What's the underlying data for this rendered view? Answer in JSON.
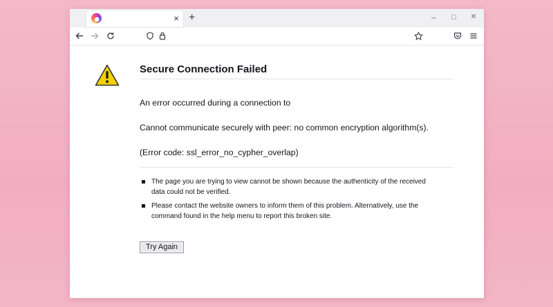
{
  "browser": {
    "tab": {
      "title": "",
      "close_glyph": "×",
      "favicon": "browser-logo-icon"
    },
    "new_tab_glyph": "+",
    "window_controls": {
      "minimize": "–",
      "maximize": "□",
      "close": "×"
    },
    "nav": {
      "back": "arrow-left-icon",
      "forward": "arrow-right-icon",
      "reload": "reload-icon",
      "address_text": ""
    }
  },
  "error_page": {
    "title": "Secure Connection Failed",
    "line1": "An error occurred during a connection to",
    "line2": "Cannot communicate securely with peer: no common encryption algorithm(s).",
    "line3": "(Error code: ssl_error_no_cypher_overlap)",
    "bullets": [
      "The page you are trying to view cannot be shown because the authenticity of the received data could not be verified.",
      "Please contact the website owners to inform them of this problem. Alternatively, use the command found in the help menu to report this broken site."
    ],
    "button": "Try Again"
  },
  "colors": {
    "background": "#f4b8c8",
    "warning_yellow": "#f5d100",
    "text": "#15141a"
  }
}
